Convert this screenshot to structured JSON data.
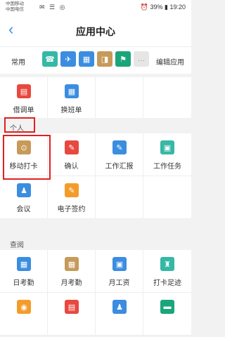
{
  "status": {
    "carrier1": "中国移动",
    "carrier2": "中国电信",
    "icons": "✉ ☰ ◎",
    "battery": "39%",
    "time": "19:20"
  },
  "header": {
    "title": "应用中心",
    "back": "‹"
  },
  "common": {
    "label": "常用",
    "edit": "编辑应用",
    "icons": [
      {
        "color": "#35b8a6",
        "glyph": "☎"
      },
      {
        "color": "#3b8de0",
        "glyph": "✈"
      },
      {
        "color": "#3b8de0",
        "glyph": "▦"
      },
      {
        "color": "#c79a5a",
        "glyph": "◨"
      },
      {
        "color": "#1aa57a",
        "glyph": "⚑"
      },
      {
        "color": "#e6e6e6",
        "glyph": "…"
      }
    ]
  },
  "top_row": [
    {
      "label": "借调单",
      "color": "#e8483f",
      "glyph": "▤"
    },
    {
      "label": "换班单",
      "color": "#3b8de0",
      "glyph": "▦"
    },
    {
      "label": "",
      "color": "",
      "glyph": ""
    },
    {
      "label": "",
      "color": "",
      "glyph": ""
    }
  ],
  "personal": {
    "title": "个人",
    "items": [
      {
        "label": "移动打卡",
        "color": "#c79a5a",
        "glyph": "⊙"
      },
      {
        "label": "确认",
        "color": "#e8483f",
        "glyph": "✎"
      },
      {
        "label": "工作汇报",
        "color": "#3b8de0",
        "glyph": "✎"
      },
      {
        "label": "工作任务",
        "color": "#35b8a6",
        "glyph": "▣"
      },
      {
        "label": "会议",
        "color": "#3b8de0",
        "glyph": "♟"
      },
      {
        "label": "电子签约",
        "color": "#f39c2b",
        "glyph": "✎"
      },
      {
        "label": "",
        "color": "",
        "glyph": ""
      },
      {
        "label": "",
        "color": "",
        "glyph": ""
      }
    ]
  },
  "query": {
    "title": "查阅",
    "items": [
      {
        "label": "日考勤",
        "color": "#3b8de0",
        "glyph": "▦"
      },
      {
        "label": "月考勤",
        "color": "#c79a5a",
        "glyph": "▦"
      },
      {
        "label": "月工资",
        "color": "#3b8de0",
        "glyph": "▣"
      },
      {
        "label": "打卡足迹",
        "color": "#35b8a6",
        "glyph": "♜"
      },
      {
        "label": "",
        "color": "#f39c2b",
        "glyph": "◉"
      },
      {
        "label": "",
        "color": "#e8483f",
        "glyph": "▤"
      },
      {
        "label": "",
        "color": "#3b8de0",
        "glyph": "♟"
      },
      {
        "label": "",
        "color": "#1aa57a",
        "glyph": "▬"
      }
    ]
  }
}
